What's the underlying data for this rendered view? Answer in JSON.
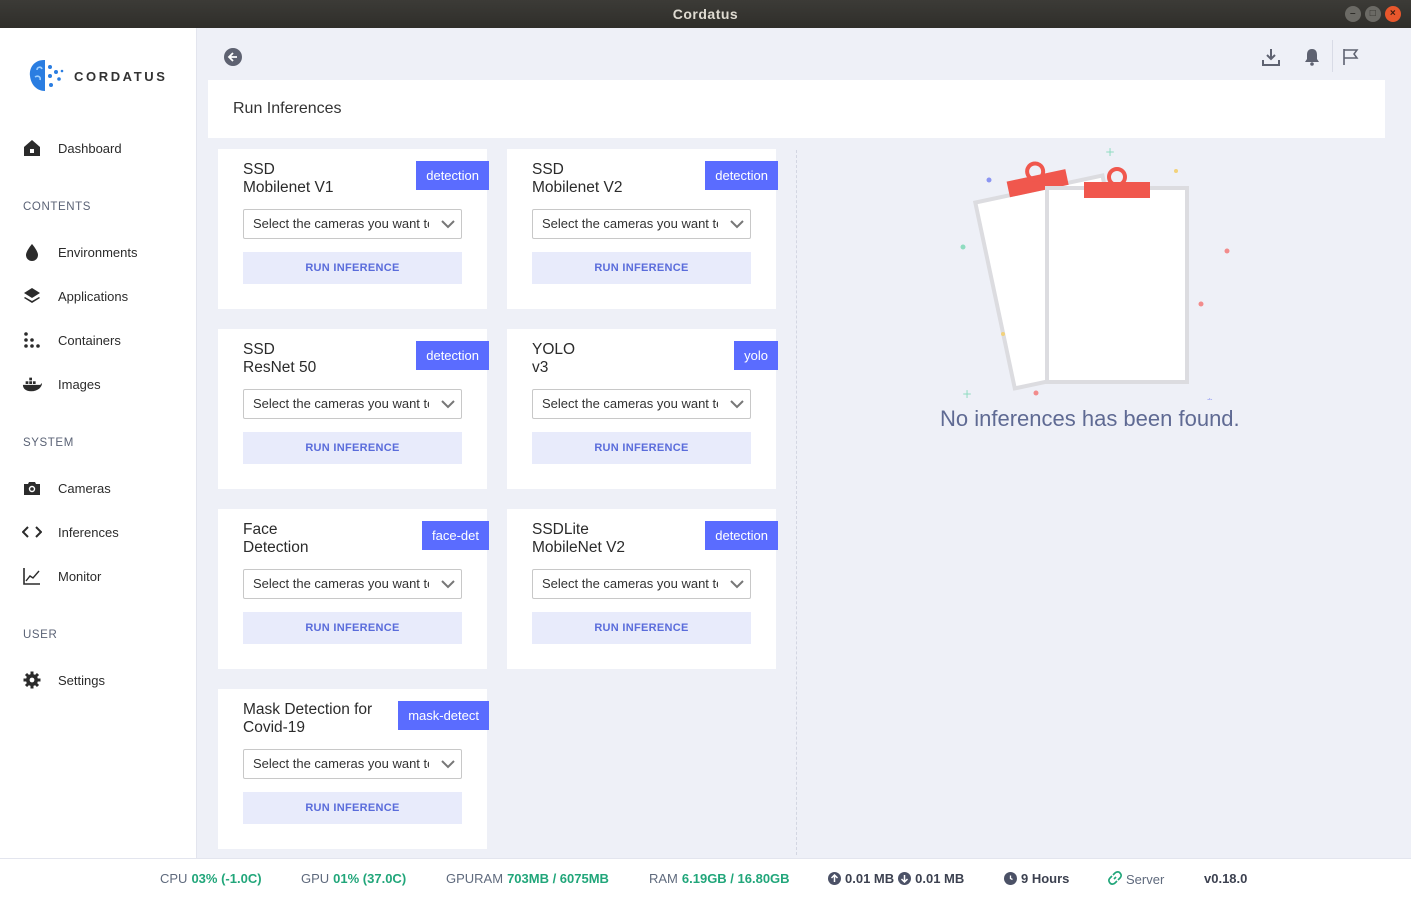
{
  "window": {
    "title": "Cordatus"
  },
  "brand": {
    "name": "CORDATUS"
  },
  "sidebar": {
    "dashboard": "Dashboard",
    "sections": {
      "contents": "CONTENTS",
      "system": "SYSTEM",
      "user": "USER"
    },
    "items": {
      "environments": "Environments",
      "applications": "Applications",
      "containers": "Containers",
      "images": "Images",
      "cameras": "Cameras",
      "inferences": "Inferences",
      "monitor": "Monitor",
      "settings": "Settings"
    }
  },
  "page": {
    "title": "Run Inferences"
  },
  "select_placeholder": "Select the cameras you want to",
  "run_label": "RUN INFERENCE",
  "cards": [
    {
      "title_line1": "SSD",
      "title_line2": "Mobilenet V1",
      "tag": "detection"
    },
    {
      "title_line1": "SSD",
      "title_line2": "Mobilenet V2",
      "tag": "detection"
    },
    {
      "title_line1": "SSD",
      "title_line2": "ResNet 50",
      "tag": "detection"
    },
    {
      "title_line1": "YOLO",
      "title_line2": "v3",
      "tag": "yolo"
    },
    {
      "title_line1": "Face",
      "title_line2": "Detection",
      "tag": "face-det"
    },
    {
      "title_line1": "SSDLite",
      "title_line2": "MobileNet V2",
      "tag": "detection"
    },
    {
      "title_line1": "Mask Detection for",
      "title_line2": "Covid-19",
      "tag": "mask-detect"
    }
  ],
  "empty_state": {
    "message": "No inferences has been found."
  },
  "footer": {
    "cpu_label": "CPU",
    "cpu_value": "03% (-1.0C)",
    "gpu_label": "GPU",
    "gpu_value": "01% (37.0C)",
    "gpuram_label": "GPURAM",
    "gpuram_value": "703MB / 6075MB",
    "ram_label": "RAM",
    "ram_value": "6.19GB / 16.80GB",
    "upload": "0.01 MB",
    "download": "0.01 MB",
    "uptime": "9 Hours",
    "server": "Server",
    "version": "v0.18.0"
  },
  "colors": {
    "accent": "#5a6cff",
    "good": "#21a67a",
    "clipboard": "#f0574d"
  }
}
